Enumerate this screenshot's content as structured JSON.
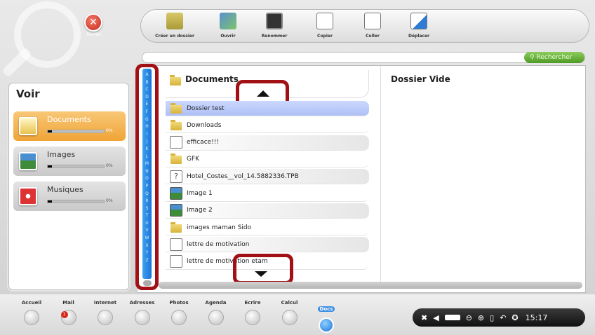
{
  "window": {
    "close_label": "Fermer"
  },
  "toolbar": {
    "items": [
      {
        "label": "Créer un dossier",
        "icon": "new-folder-icon"
      },
      {
        "label": "Ouvrir",
        "icon": "open-icon"
      },
      {
        "label": "Renommer",
        "icon": "rename-icon"
      },
      {
        "label": "Copier",
        "icon": "copy-icon"
      },
      {
        "label": "Coller",
        "icon": "paste-icon"
      },
      {
        "label": "Déplacer",
        "icon": "move-icon"
      }
    ]
  },
  "search": {
    "button_label": "Rechercher",
    "value": ""
  },
  "voir": {
    "title": "Voir",
    "categories": [
      {
        "label": "Documents",
        "percent": "0%",
        "fill": 0.08
      },
      {
        "label": "Images",
        "percent": "0%",
        "fill": 0.08
      },
      {
        "label": "Musiques",
        "percent": "0%",
        "fill": 0.08
      }
    ]
  },
  "alphabet": [
    "A",
    "B",
    "C",
    "D",
    "E",
    "F",
    "G",
    "H",
    "I",
    "J",
    "K",
    "L",
    "M",
    "N",
    "O",
    "P",
    "Q",
    "R",
    "S",
    "T",
    "U",
    "V",
    "W",
    "X",
    "Y",
    "Z"
  ],
  "browser": {
    "folder_name": "Documents",
    "files": [
      {
        "name": "Dossier test",
        "type": "folder",
        "state": "selected"
      },
      {
        "name": "Downloads",
        "type": "folder",
        "state": ""
      },
      {
        "name": "efficace!!!",
        "type": "doc",
        "state": "shaded"
      },
      {
        "name": "GFK",
        "type": "folder",
        "state": ""
      },
      {
        "name": "Hotel_Costes__vol_14.5882336.TPB",
        "type": "unknown",
        "state": "shaded"
      },
      {
        "name": "Image 1",
        "type": "image",
        "state": ""
      },
      {
        "name": "Image 2",
        "type": "image",
        "state": "shaded"
      },
      {
        "name": "images maman Sido",
        "type": "folder",
        "state": ""
      },
      {
        "name": "lettre de motivation",
        "type": "doc",
        "state": "shaded"
      },
      {
        "name": "lettre de motivation etam",
        "type": "doc",
        "state": ""
      }
    ]
  },
  "detail": {
    "title": "Dossier Vide"
  },
  "dock": {
    "items": [
      {
        "label": "Accueil",
        "icon": "home-icon"
      },
      {
        "label": "Mail",
        "icon": "mail-icon",
        "badge": "1"
      },
      {
        "label": "Internet",
        "icon": "internet-icon"
      },
      {
        "label": "Adresses",
        "icon": "contacts-icon"
      },
      {
        "label": "Photos",
        "icon": "photos-icon"
      },
      {
        "label": "Agenda",
        "icon": "calendar-icon"
      },
      {
        "label": "Ecrire",
        "icon": "write-icon"
      },
      {
        "label": "Calcul",
        "icon": "calculator-icon"
      },
      {
        "label": "Docs",
        "icon": "docs-icon",
        "active": true
      }
    ]
  },
  "tray": {
    "time": "15:17"
  },
  "colors": {
    "active_orange": "#f0a436",
    "selection_blue": "#aebff5",
    "alphabet_blue": "#1a74d6",
    "annotation_red": "#a01015",
    "search_green": "#4f9a25"
  }
}
